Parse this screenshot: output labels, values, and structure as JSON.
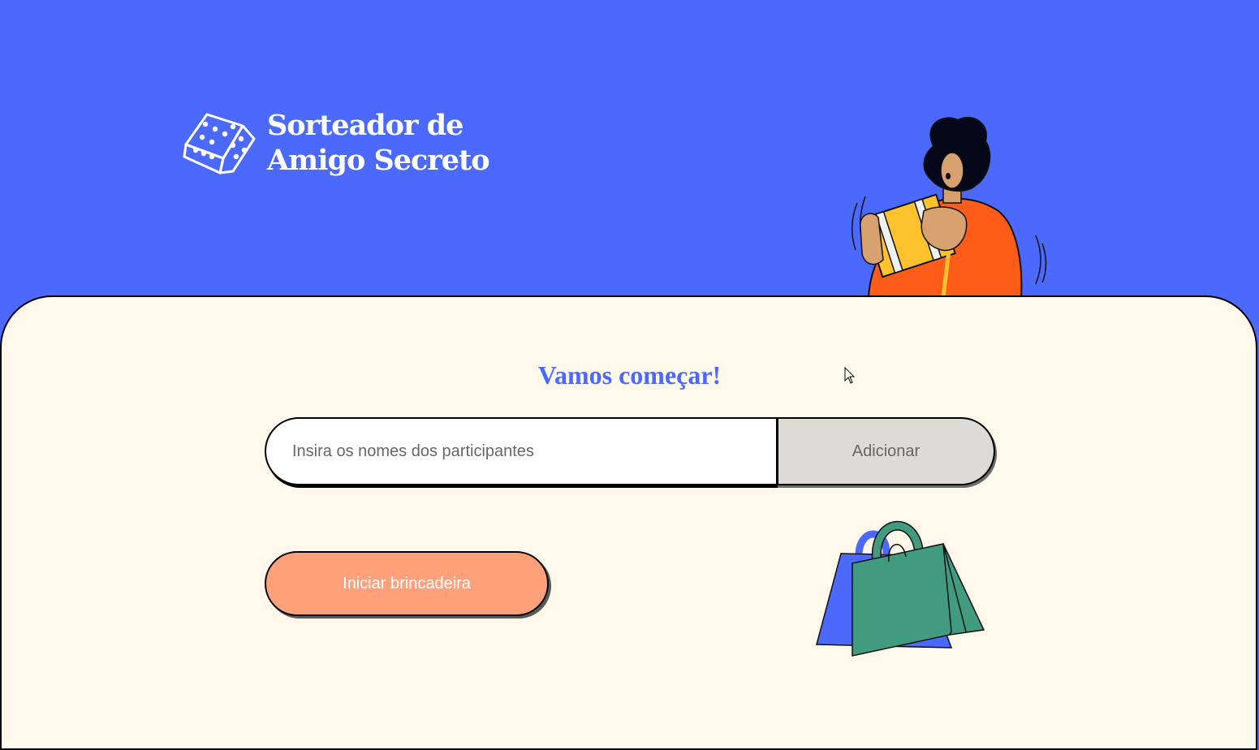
{
  "header": {
    "title_line1": "Sorteador de",
    "title_line2": "Amigo Secreto",
    "logo_icon": "dice-icon",
    "illustration": "person-holding-gift-illustration"
  },
  "main": {
    "title": "Vamos começar!",
    "name_input": {
      "value": "",
      "placeholder": "Insira os nomes dos participantes"
    },
    "add_button_label": "Adicionar",
    "start_button_label": "Iniciar brincadeira",
    "illustration": "shopping-bags-illustration"
  },
  "colors": {
    "primary_blue": "#4b69fd",
    "background_cream": "#fff8eb",
    "button_orange": "#fea17b",
    "button_gray": "#dcdbd6",
    "bag_green": "#419b7f"
  }
}
